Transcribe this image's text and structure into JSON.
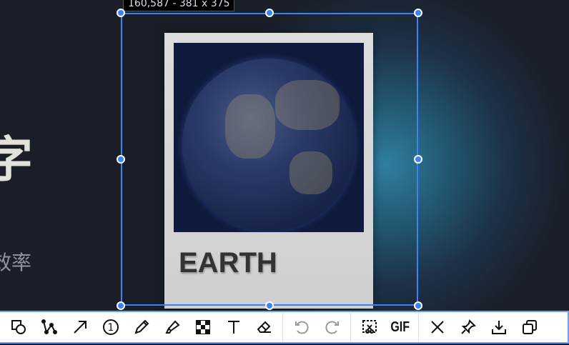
{
  "background": {
    "heading_fragment": "字",
    "subtitle_fragment": "效率"
  },
  "card": {
    "title": "EARTH"
  },
  "selection": {
    "readout": "160,587 - 381 x 375"
  },
  "toolbar": {
    "gif_label": "GIF",
    "number_marker": "1"
  },
  "colors": {
    "accent": "#3b82f6"
  }
}
